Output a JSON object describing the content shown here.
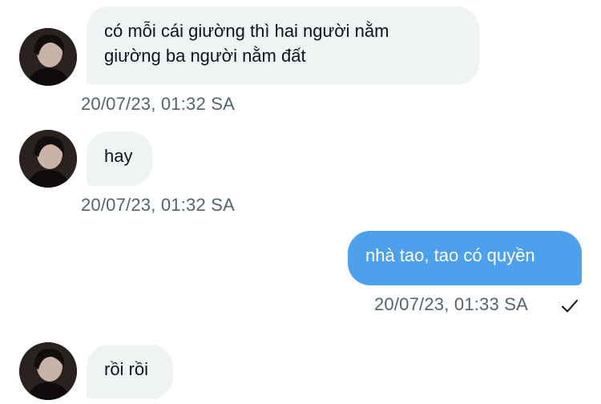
{
  "messages": [
    {
      "direction": "in",
      "lines": [
        "có mỗi cái giường thì hai người nằm",
        "giường ba người nằm đất"
      ],
      "timestamp": "20/07/23, 01:32 SA"
    },
    {
      "direction": "in",
      "text": "hay",
      "timestamp": "20/07/23, 01:32 SA"
    },
    {
      "direction": "out",
      "text": "nhà tao, tao có quyền",
      "timestamp": "20/07/23, 01:33 SA",
      "status_icon": "check-icon"
    },
    {
      "direction": "in",
      "text": "rồi rồi"
    }
  ],
  "colors": {
    "incoming_bubble": "#eff3f4",
    "outgoing_bubble": "#4ca0ec",
    "timestamp": "#536471",
    "text": "#0f1419"
  }
}
